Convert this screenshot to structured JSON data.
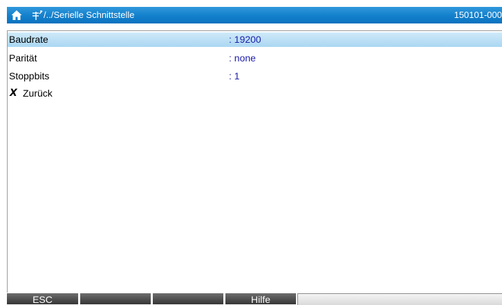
{
  "header": {
    "path": "/../Serielle Schnittstelle",
    "device_id": "150101-000"
  },
  "menu": {
    "items": [
      {
        "label": "Baudrate",
        "value": ": 19200",
        "selected": true
      },
      {
        "label": "Parität",
        "value": ": none",
        "selected": false
      },
      {
        "label": "Stoppbits",
        "value": ": 1",
        "selected": false
      }
    ],
    "back": {
      "icon": "X",
      "label": "Zurück"
    }
  },
  "softkeys": {
    "esc": "ESC",
    "key2": "",
    "key3": "",
    "help": "Hilfe"
  },
  "colors": {
    "header": "#1380cc",
    "selection": "#aad7f2",
    "value_text": "#1f1faa"
  },
  "icons": {
    "home": "home-icon",
    "path": "settings-path-icon"
  }
}
